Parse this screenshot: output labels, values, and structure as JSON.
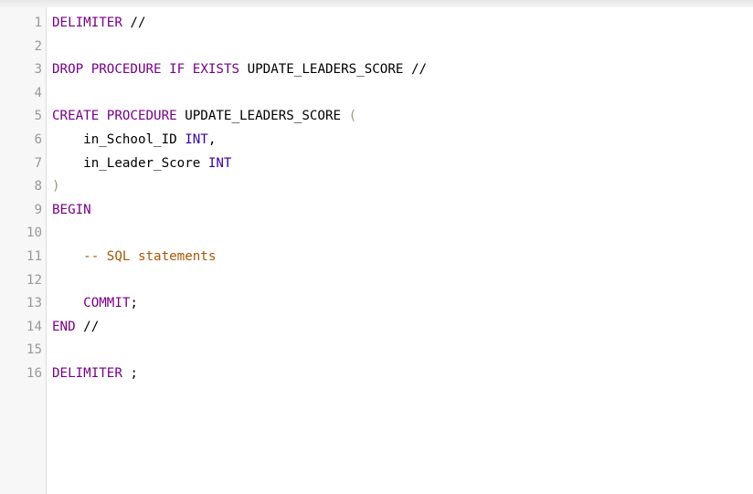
{
  "editor": {
    "lines": [
      {
        "num": "1",
        "tokens": [
          {
            "t": "DELIMITER",
            "c": "kw"
          },
          {
            "t": " //",
            "c": "pl"
          }
        ]
      },
      {
        "num": "2",
        "tokens": []
      },
      {
        "num": "3",
        "tokens": [
          {
            "t": "DROP",
            "c": "kw"
          },
          {
            "t": " ",
            "c": "pl"
          },
          {
            "t": "PROCEDURE",
            "c": "kw"
          },
          {
            "t": " ",
            "c": "pl"
          },
          {
            "t": "IF",
            "c": "kw"
          },
          {
            "t": " ",
            "c": "pl"
          },
          {
            "t": "EXISTS",
            "c": "kw"
          },
          {
            "t": " UPDATE_LEADERS_SCORE //",
            "c": "pl"
          }
        ]
      },
      {
        "num": "4",
        "tokens": []
      },
      {
        "num": "5",
        "tokens": [
          {
            "t": "CREATE",
            "c": "kw"
          },
          {
            "t": " ",
            "c": "pl"
          },
          {
            "t": "PROCEDURE",
            "c": "kw"
          },
          {
            "t": " UPDATE_LEADERS_SCORE ",
            "c": "pl"
          },
          {
            "t": "(",
            "c": "br"
          }
        ]
      },
      {
        "num": "6",
        "tokens": [
          {
            "t": "    in_School_ID ",
            "c": "pl"
          },
          {
            "t": "INT",
            "c": "ty"
          },
          {
            "t": ",",
            "c": "pl"
          }
        ]
      },
      {
        "num": "7",
        "tokens": [
          {
            "t": "    in_Leader_Score ",
            "c": "pl"
          },
          {
            "t": "INT",
            "c": "ty"
          }
        ]
      },
      {
        "num": "8",
        "tokens": [
          {
            "t": ")",
            "c": "br"
          }
        ]
      },
      {
        "num": "9",
        "tokens": [
          {
            "t": "BEGIN",
            "c": "kw"
          }
        ]
      },
      {
        "num": "10",
        "tokens": []
      },
      {
        "num": "11",
        "tokens": [
          {
            "t": "    ",
            "c": "pl"
          },
          {
            "t": "-- SQL statements",
            "c": "cm"
          }
        ]
      },
      {
        "num": "12",
        "tokens": []
      },
      {
        "num": "13",
        "tokens": [
          {
            "t": "    ",
            "c": "pl"
          },
          {
            "t": "COMMIT",
            "c": "kw"
          },
          {
            "t": ";",
            "c": "pl"
          }
        ]
      },
      {
        "num": "14",
        "tokens": [
          {
            "t": "END",
            "c": "kw"
          },
          {
            "t": " //",
            "c": "pl"
          }
        ]
      },
      {
        "num": "15",
        "tokens": []
      },
      {
        "num": "16",
        "tokens": [
          {
            "t": "DELIMITER",
            "c": "kw"
          },
          {
            "t": " ;",
            "c": "pl"
          }
        ]
      }
    ]
  },
  "colors": {
    "keyword": "#770088",
    "type": "#3300aa",
    "comment": "#aa5500",
    "bracket": "#999977",
    "line_number": "#999999",
    "gutter_bg": "#f7f7f7"
  }
}
